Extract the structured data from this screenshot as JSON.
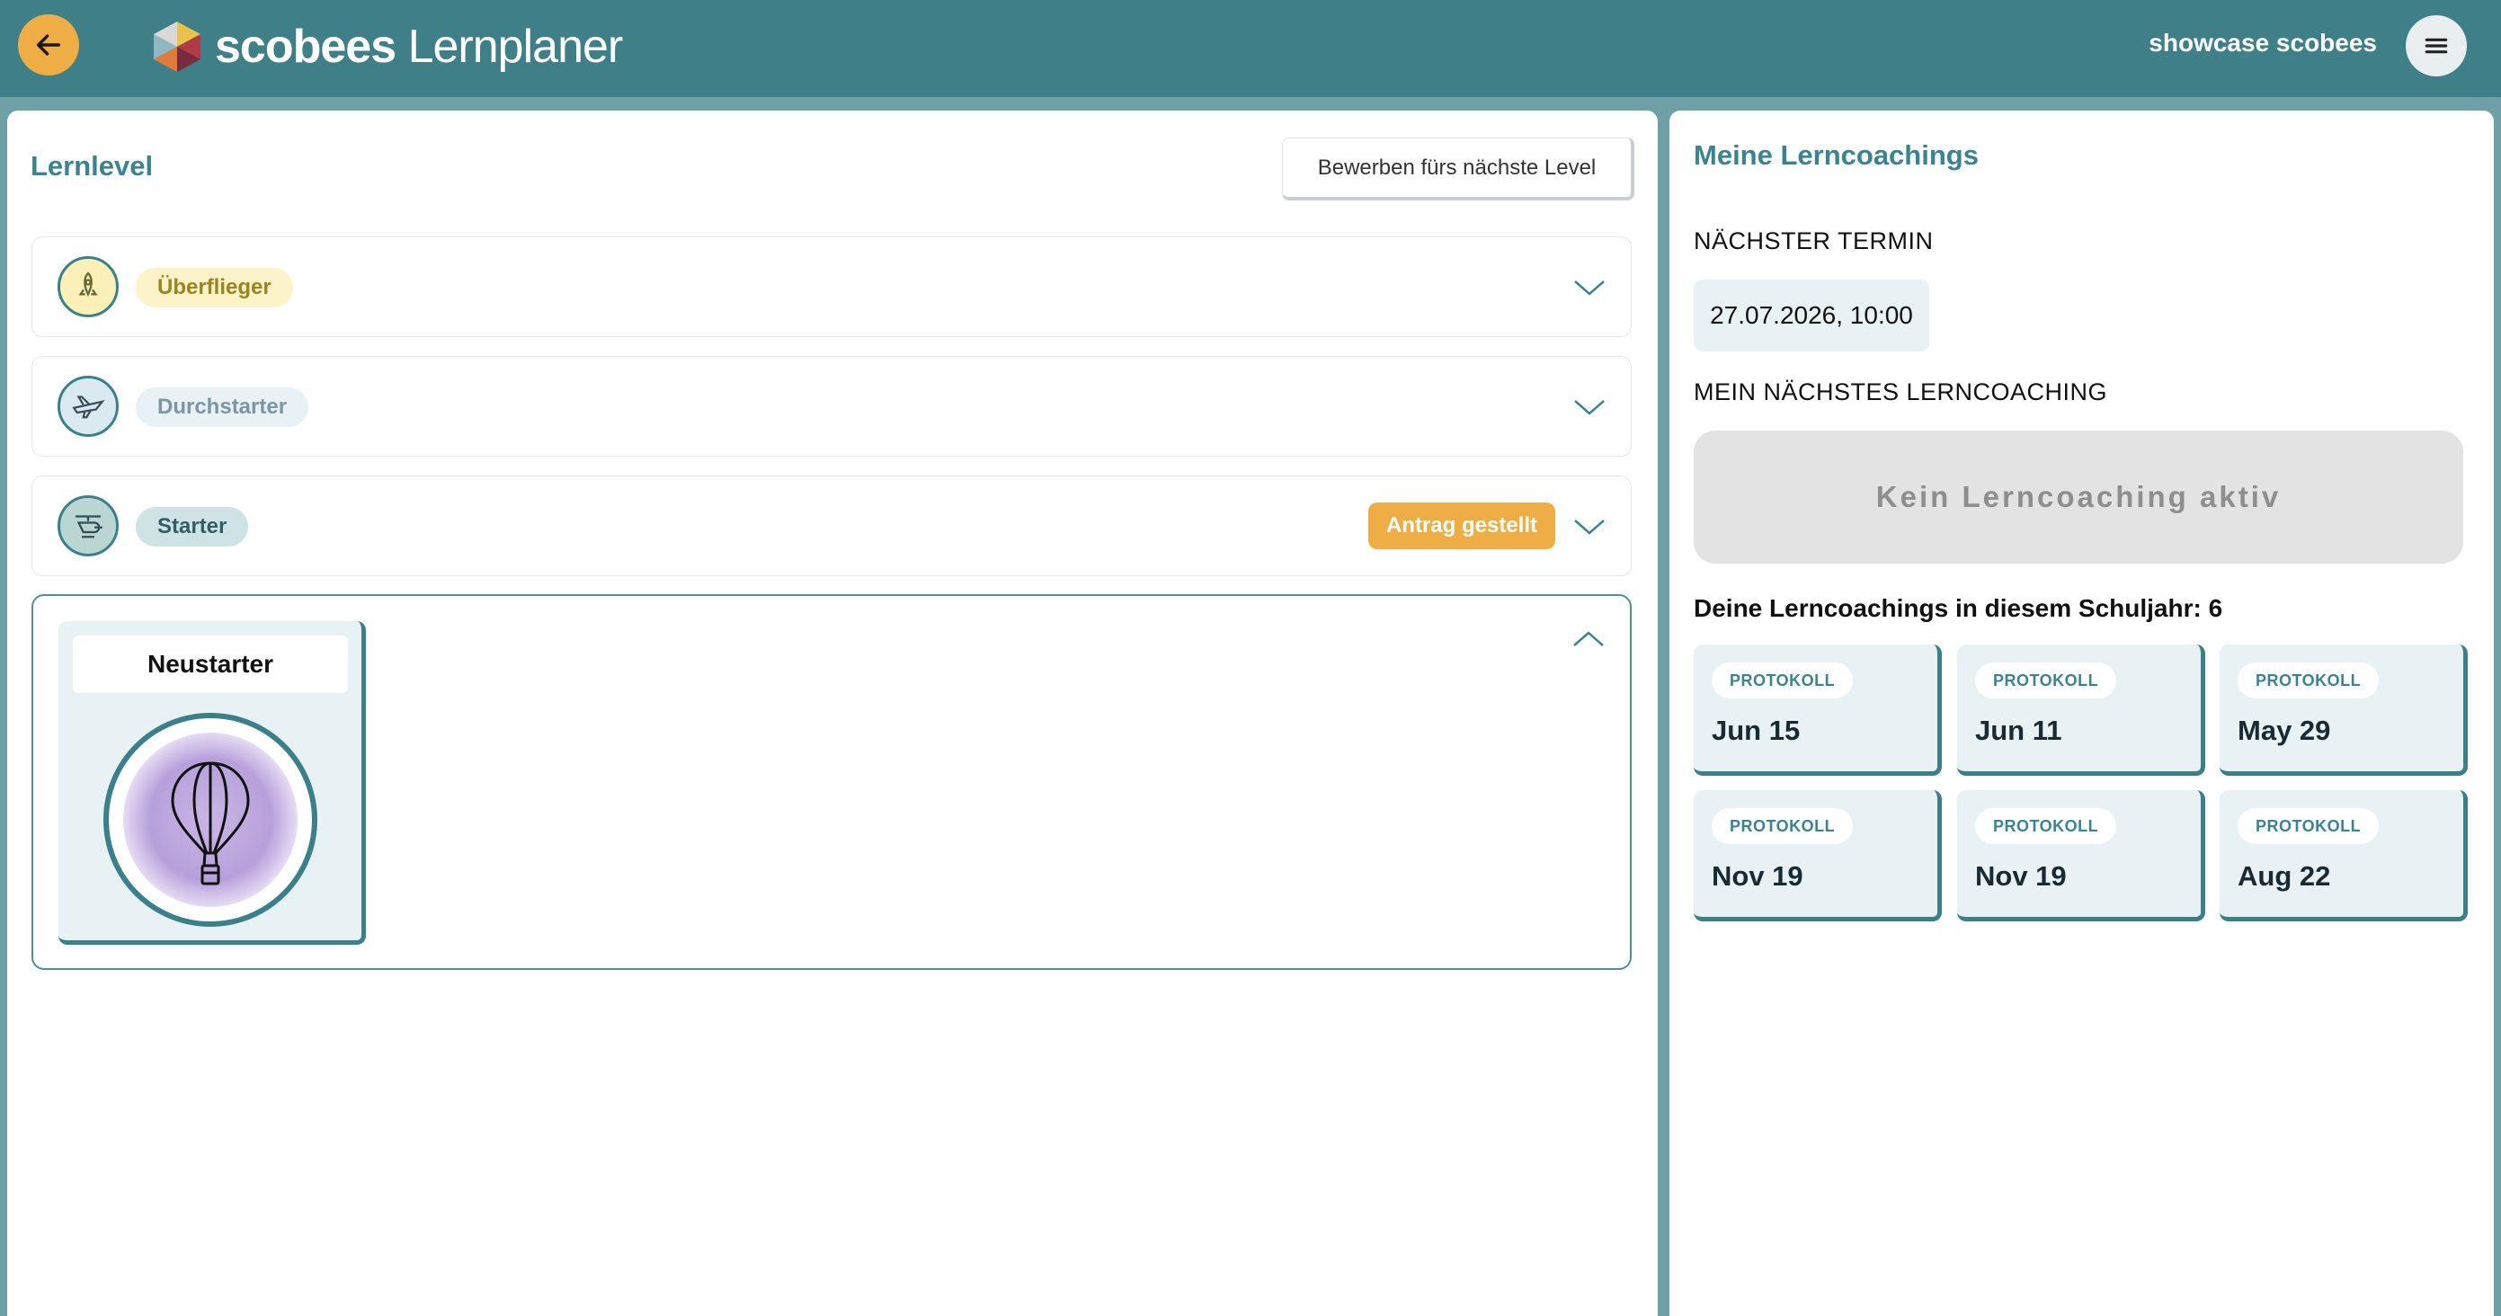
{
  "header": {
    "logo_bold": "scobees",
    "logo_light": "Lernplaner",
    "user_name": "showcase scobees",
    "back_icon": "arrow-left-icon",
    "menu_icon": "hamburger-menu-icon"
  },
  "lernlevel": {
    "title": "Lernlevel",
    "apply_button": "Bewerben fürs nächste Level",
    "levels": [
      {
        "name": "Überflieger",
        "icon": "rocket-icon",
        "badge_bg": "#fdf3c8",
        "badge_color": "#9a8420",
        "status": ""
      },
      {
        "name": "Durchstarter",
        "icon": "airplane-icon",
        "badge_bg": "#e8f1f6",
        "badge_color": "#7c97a3",
        "status": ""
      },
      {
        "name": "Starter",
        "icon": "helicopter-icon",
        "badge_bg": "#cfe3e4",
        "badge_color": "#2f5f68",
        "status": "Antrag gestellt"
      }
    ],
    "current": {
      "name": "Neustarter",
      "icon": "hot-air-balloon-icon"
    }
  },
  "coachings": {
    "title": "Meine Lerncoachings",
    "next_date_label": "NÄCHSTER TERMIN",
    "next_date": "27.07.2026, 10:00",
    "next_coaching_label": "MEIN NÄCHSTES LERNCOACHING",
    "no_coaching": "Kein Lerncoaching aktiv",
    "year_count": "Deine Lerncoachings in diesem Schuljahr: 6",
    "protocols": [
      {
        "tag": "PROTOKOLL",
        "date": "Jun 15"
      },
      {
        "tag": "PROTOKOLL",
        "date": "Jun 11"
      },
      {
        "tag": "PROTOKOLL",
        "date": "May 29"
      },
      {
        "tag": "PROTOKOLL",
        "date": "Nov 19"
      },
      {
        "tag": "PROTOKOLL",
        "date": "Nov 19"
      },
      {
        "tag": "PROTOKOLL",
        "date": "Aug 22"
      }
    ]
  },
  "colors": {
    "header": "#3f8088",
    "accent": "#eeae45",
    "teal": "#3b8390"
  }
}
